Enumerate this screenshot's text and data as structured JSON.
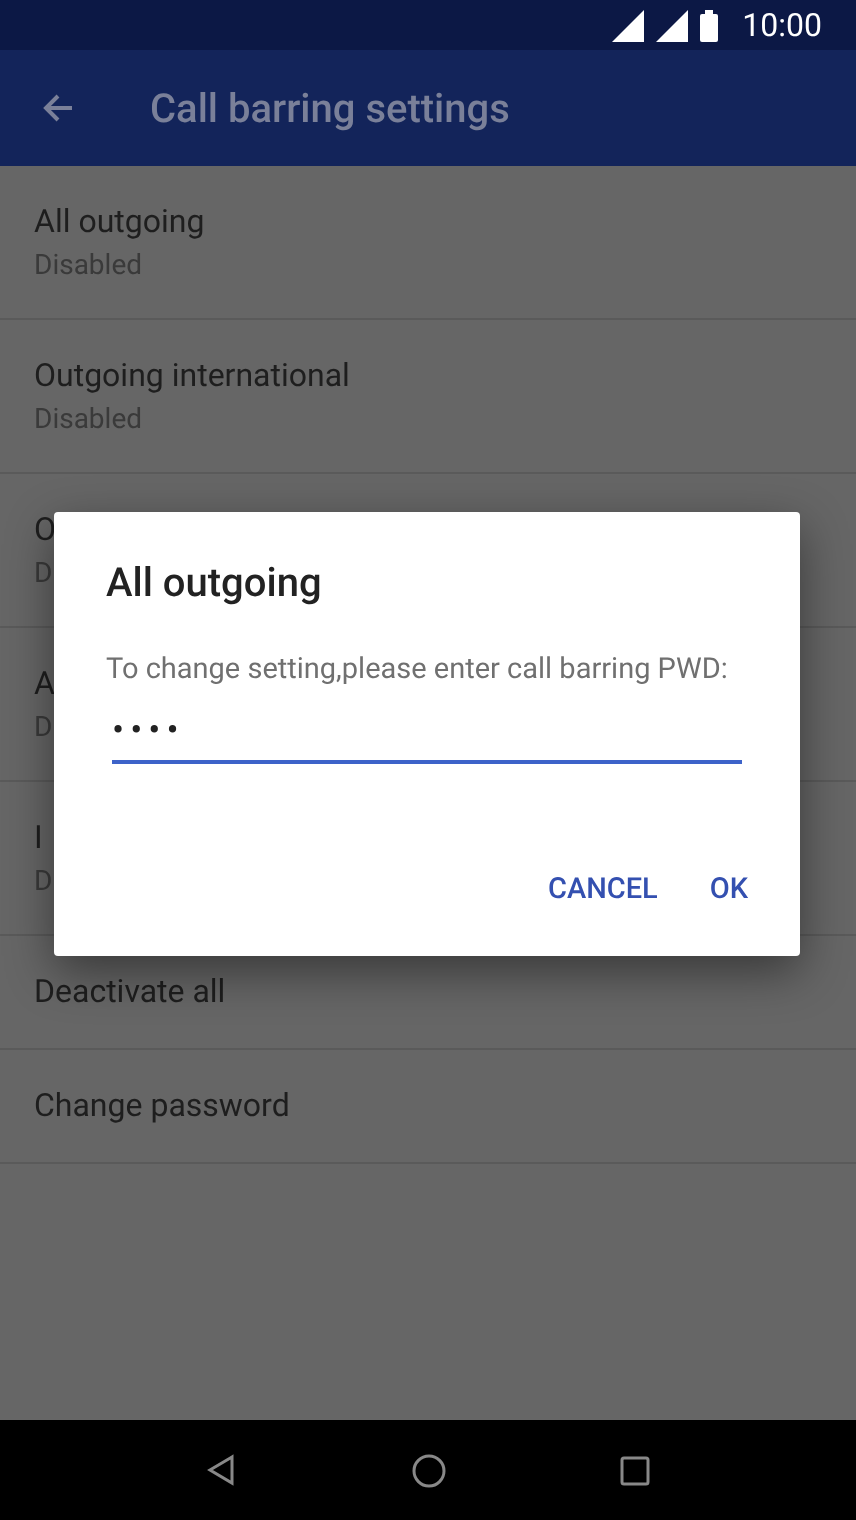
{
  "status_bar": {
    "time": "10:00"
  },
  "app_bar": {
    "title": "Call barring settings"
  },
  "settings": [
    {
      "title": "All outgoing",
      "subtitle": "Disabled"
    },
    {
      "title": "Outgoing international",
      "subtitle": "Disabled"
    },
    {
      "title": "O",
      "subtitle": "D"
    },
    {
      "title": "A",
      "subtitle": "D"
    },
    {
      "title": "I",
      "subtitle": "D"
    },
    {
      "title": "Deactivate all"
    },
    {
      "title": "Change password"
    }
  ],
  "dialog": {
    "title": "All outgoing",
    "message": "To change setting,please enter call barring PWD:",
    "password_value": "••••",
    "buttons": [
      "CANCEL",
      "OK"
    ]
  }
}
